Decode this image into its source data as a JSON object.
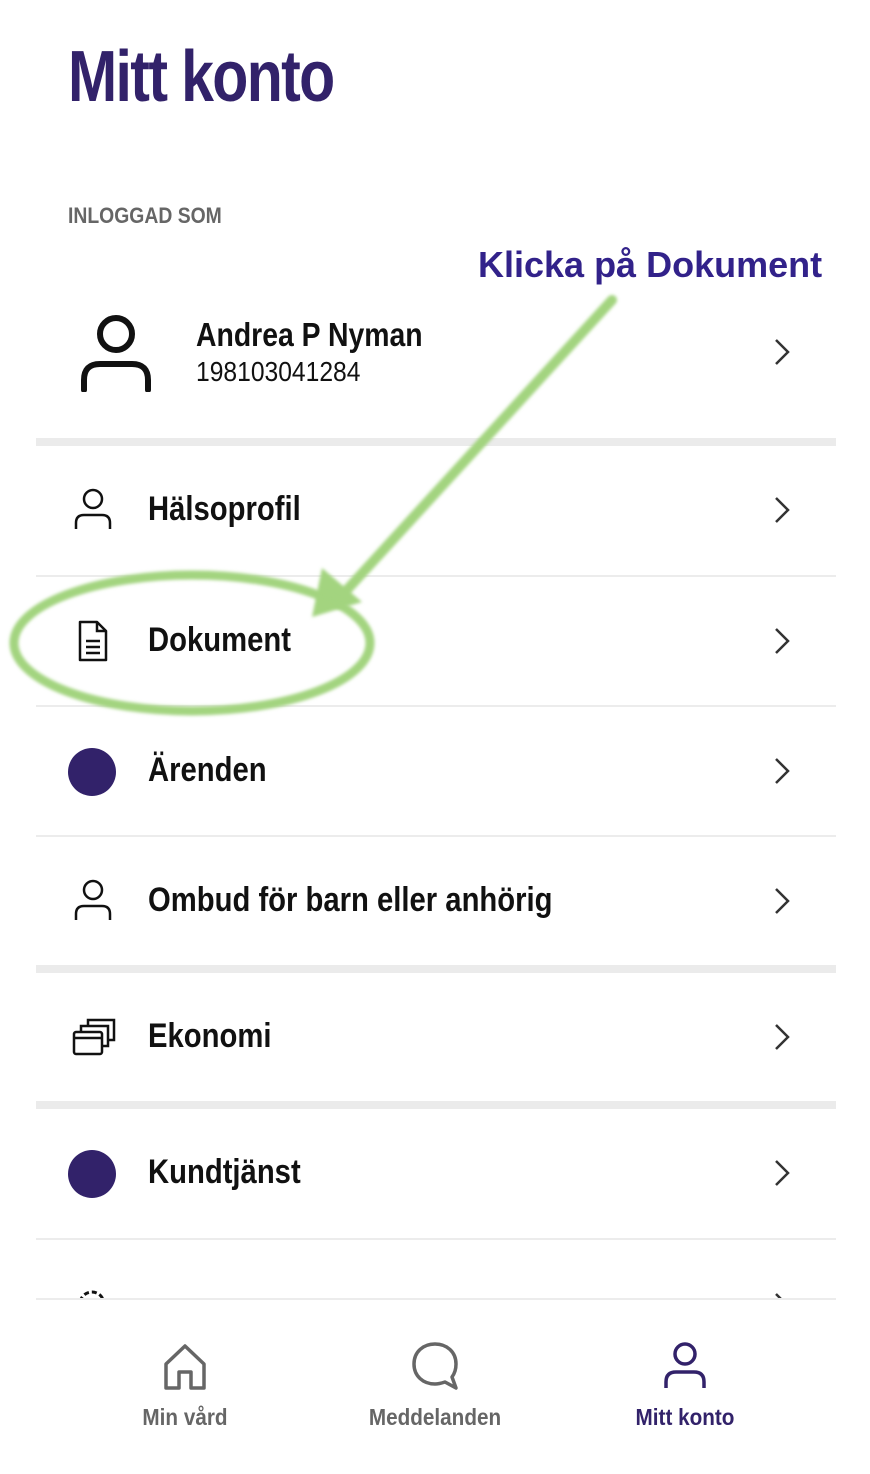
{
  "header": {
    "title": "Mitt konto"
  },
  "account": {
    "section_label": "INLOGGAD SOM",
    "name": "Andrea P Nyman",
    "personal_number": "198103041284"
  },
  "menu": {
    "items": [
      {
        "label": "Hälsoprofil",
        "icon": "person-icon"
      },
      {
        "label": "Dokument",
        "icon": "document-icon"
      },
      {
        "label": "Ärenden",
        "icon": "filled-circle-icon"
      },
      {
        "label": "Ombud för barn eller anhörig",
        "icon": "person-icon"
      },
      {
        "label": "Ekonomi",
        "icon": "cards-icon"
      },
      {
        "label": "Kundtjänst",
        "icon": "filled-circle-icon"
      }
    ]
  },
  "annotation": {
    "text": "Klicka på Dokument",
    "color": "#a3d47f"
  },
  "bottom_nav": {
    "items": [
      {
        "label": "Min vård",
        "icon": "home-icon"
      },
      {
        "label": "Meddelanden",
        "icon": "chat-bubble-icon"
      },
      {
        "label": "Mitt konto",
        "icon": "person-icon",
        "active": true
      }
    ]
  },
  "colors": {
    "brand": "#32226a",
    "muted": "#666666",
    "separator": "#ebebeb"
  }
}
